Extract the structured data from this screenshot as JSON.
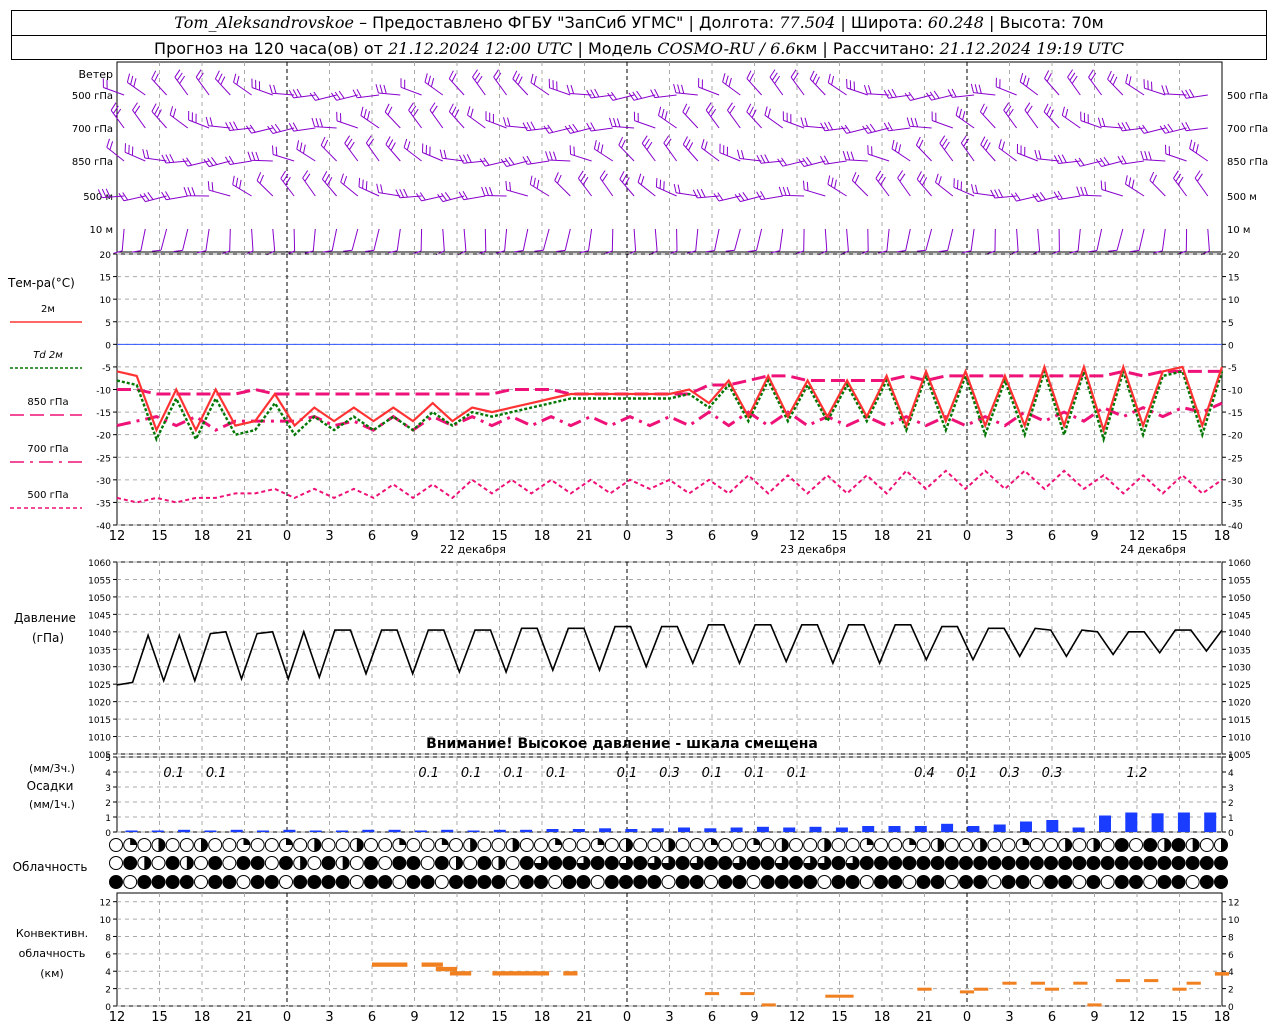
{
  "header": {
    "station": "Tom_Aleksandrovskoe",
    "provider": "Предоставлено ФГБУ \"ЗапСиб УГМС\"",
    "lon_label": "Долгота:",
    "lon": "77.504",
    "lat_label": "Широта:",
    "lat": "60.248",
    "alt_label": "Высота:",
    "alt": "70м",
    "forecast_label": "Прогноз на 120 часа(ов) от",
    "forecast_time": "21.12.2024 12:00 UTC",
    "model_label": "Модель",
    "model": "COSMO-RU / 6.6",
    "model_unit": "км",
    "calc_label": "Рассчитано:",
    "calc_time": "21.12.2024 19:19 UTC"
  },
  "colors": {
    "wind": "#8800cc",
    "t2m": "#ff3333",
    "td2m": "#007700",
    "t850": "#ee1177",
    "t700": "#ee1177",
    "t500": "#ee1177",
    "zero_line": "#3355ff",
    "pressure": "#000000",
    "precip": "#1a3cff",
    "convective": "#f08020"
  },
  "chart_data": [
    {
      "type": "barbs",
      "title": "Ветер",
      "levels": [
        "500 гПа",
        "700 гПа",
        "850 гПа",
        "500 м",
        "10 м"
      ]
    },
    {
      "type": "line",
      "title": "Тем-ра(°C)",
      "ylim": [
        -40,
        20
      ],
      "yticks": [
        20,
        15,
        10,
        5,
        0,
        -5,
        -10,
        -15,
        -20,
        -25,
        -30,
        -35,
        -40
      ],
      "xticks": [
        "12",
        "15",
        "18",
        "21",
        "0",
        "3",
        "6",
        "9",
        "12",
        "15",
        "18",
        "21",
        "0",
        "3",
        "6",
        "9",
        "12",
        "15",
        "18",
        "21",
        "0",
        "3",
        "6",
        "9",
        "12",
        "15",
        "18"
      ],
      "date_labels": [
        "22 декабря",
        "23 декабря",
        "24 декабря"
      ],
      "series": [
        {
          "name": "2м",
          "values": [
            -6,
            -7,
            -19,
            -10,
            -19,
            -10,
            -18,
            -17,
            -11,
            -18,
            -14,
            -17,
            -14,
            -17,
            -14,
            -17,
            -13,
            -17,
            -14,
            -15,
            -14,
            -13,
            -12,
            -11,
            -11,
            -11,
            -11,
            -11,
            -11,
            -10,
            -13,
            -8,
            -16,
            -7,
            -16,
            -8,
            -16,
            -8,
            -16,
            -7,
            -18,
            -6,
            -17,
            -6,
            -18,
            -7,
            -18,
            -5,
            -18,
            -5,
            -19,
            -5,
            -18,
            -6,
            -5,
            -18,
            -5
          ]
        },
        {
          "name": "Td 2м",
          "values": [
            -8,
            -9,
            -21,
            -12,
            -21,
            -12,
            -20,
            -19,
            -13,
            -20,
            -16,
            -19,
            -16,
            -19,
            -16,
            -19,
            -15,
            -18,
            -15,
            -16,
            -15,
            -14,
            -13,
            -12,
            -12,
            -12,
            -12,
            -12,
            -12,
            -11,
            -14,
            -9,
            -17,
            -8,
            -17,
            -9,
            -17,
            -9,
            -17,
            -8,
            -19,
            -7,
            -19,
            -7,
            -20,
            -8,
            -20,
            -6,
            -20,
            -6,
            -21,
            -6,
            -20,
            -7,
            -6,
            -20,
            -6
          ]
        },
        {
          "name": "850 гПа",
          "values": [
            -10,
            -10,
            -11,
            -11,
            -11,
            -11,
            -11,
            -10,
            -11,
            -11,
            -11,
            -11,
            -11,
            -11,
            -11,
            -11,
            -11,
            -11,
            -11,
            -11,
            -10,
            -10,
            -10,
            -11,
            -11,
            -11,
            -11,
            -11,
            -11,
            -11,
            -9,
            -9,
            -8,
            -7,
            -7,
            -8,
            -8,
            -8,
            -8,
            -8,
            -7,
            -8,
            -7,
            -7,
            -7,
            -7,
            -7,
            -7,
            -7,
            -7,
            -7,
            -6,
            -7,
            -6,
            -6,
            -6,
            -6
          ]
        },
        {
          "name": "700 гПа",
          "values": [
            -18,
            -17,
            -16,
            -18,
            -16,
            -19,
            -17,
            -17,
            -17,
            -17,
            -16,
            -18,
            -17,
            -19,
            -16,
            -19,
            -16,
            -18,
            -16,
            -18,
            -16,
            -18,
            -16,
            -18,
            -16,
            -18,
            -16,
            -18,
            -16,
            -18,
            -15,
            -18,
            -15,
            -18,
            -15,
            -18,
            -16,
            -18,
            -16,
            -18,
            -16,
            -18,
            -16,
            -18,
            -16,
            -18,
            -15,
            -17,
            -15,
            -17,
            -14,
            -16,
            -14,
            -16,
            -14,
            -15,
            -13
          ]
        },
        {
          "name": "500 гПа",
          "values": [
            -34,
            -35,
            -34,
            -35,
            -34,
            -34,
            -33,
            -33,
            -32,
            -34,
            -32,
            -34,
            -32,
            -34,
            -31,
            -34,
            -31,
            -34,
            -30,
            -33,
            -30,
            -33,
            -30,
            -33,
            -30,
            -33,
            -30,
            -32,
            -30,
            -33,
            -30,
            -33,
            -29,
            -33,
            -29,
            -33,
            -29,
            -33,
            -29,
            -33,
            -28,
            -32,
            -28,
            -32,
            -28,
            -32,
            -28,
            -32,
            -28,
            -32,
            -29,
            -33,
            -29,
            -33,
            -29,
            -33,
            -30
          ]
        }
      ]
    },
    {
      "type": "line",
      "title": "Давление",
      "units": "(гПа)",
      "ylim": [
        1005,
        1060
      ],
      "yticks": [
        1060,
        1055,
        1050,
        1045,
        1040,
        1035,
        1030,
        1025,
        1020,
        1015,
        1010,
        1005
      ],
      "warning": "Внимание! Высокое давление - шкала смещена",
      "series": [
        {
          "name": "pressure",
          "values": [
            1024.8,
            1025.5,
            1039.0,
            1026.0,
            1039.0,
            1026.0,
            1039.5,
            1040.0,
            1026.5,
            1039.5,
            1040.0,
            1026.5,
            1040.0,
            1027.0,
            1040.5,
            1040.5,
            1028.0,
            1040.5,
            1040.5,
            1028.0,
            1040.5,
            1040.5,
            1028.5,
            1040.5,
            1040.5,
            1028.5,
            1041.0,
            1041.0,
            1029.0,
            1041.0,
            1041.0,
            1029.0,
            1041.5,
            1041.5,
            1030.0,
            1041.5,
            1041.5,
            1031.0,
            1042.0,
            1042.0,
            1031.0,
            1042.0,
            1042.0,
            1031.5,
            1042.0,
            1042.0,
            1031.0,
            1042.0,
            1042.0,
            1031.0,
            1042.0,
            1042.0,
            1032.0,
            1041.5,
            1041.5,
            1032.0,
            1041.0,
            1041.0,
            1033.0,
            1041.0,
            1040.5,
            1033.0,
            1040.5,
            1040.0,
            1033.5,
            1040.0,
            1040.0,
            1034.0,
            1040.5,
            1040.5,
            1034.5,
            1040.5
          ]
        }
      ]
    },
    {
      "type": "bar",
      "title": "Осадки",
      "units_3h": "(мм/3ч.)",
      "units_1h": "(мм/1ч.)",
      "ylim": [
        0,
        5
      ],
      "yticks": [
        5,
        4,
        3,
        2,
        1,
        0
      ],
      "labels_3h": [
        "0.1",
        "0.1",
        "0.1",
        "0.1",
        "0.1",
        "0.1",
        "0.1",
        "0.3",
        "0.1",
        "0.1",
        "0.1",
        "0.4",
        "0.1",
        "0.3",
        "0.3",
        "1.2"
      ],
      "values": [
        0.1,
        0.1,
        0.15,
        0.1,
        0.15,
        0.1,
        0.15,
        0.1,
        0.1,
        0.15,
        0.15,
        0.1,
        0.15,
        0.1,
        0.15,
        0.15,
        0.2,
        0.2,
        0.25,
        0.2,
        0.25,
        0.3,
        0.25,
        0.3,
        0.35,
        0.3,
        0.35,
        0.3,
        0.4,
        0.4,
        0.4,
        0.55,
        0.4,
        0.5,
        0.7,
        0.8,
        0.3,
        1.1,
        1.3,
        1.25,
        1.3,
        1.3
      ]
    },
    {
      "type": "table",
      "title": "Облачность",
      "rows": 3,
      "note": "cloud cover symbols per time step (high / middle / low)"
    },
    {
      "type": "bar",
      "title": "Конвективн. облачность",
      "units": "(км)",
      "ylim": [
        0,
        13
      ],
      "yticks": [
        12,
        10,
        8,
        6,
        4,
        2,
        0
      ],
      "segments": [
        {
          "x0": 18.0,
          "x1": 20.5,
          "y0": 4.5,
          "y1": 5.0
        },
        {
          "x0": 21.5,
          "x1": 23.0,
          "y0": 4.5,
          "y1": 5.0
        },
        {
          "x0": 22.5,
          "x1": 24.0,
          "y0": 4.0,
          "y1": 4.5
        },
        {
          "x0": 23.5,
          "x1": 25.0,
          "y0": 3.5,
          "y1": 4.0
        },
        {
          "x0": 26.5,
          "x1": 30.5,
          "y0": 3.5,
          "y1": 4.0
        },
        {
          "x0": 31.5,
          "x1": 32.5,
          "y0": 3.5,
          "y1": 4.0
        },
        {
          "x0": 41.5,
          "x1": 42.5,
          "y0": 1.3,
          "y1": 1.6
        },
        {
          "x0": 44.0,
          "x1": 45.0,
          "y0": 1.3,
          "y1": 1.6
        },
        {
          "x0": 45.5,
          "x1": 46.5,
          "y0": 0.0,
          "y1": 0.3
        },
        {
          "x0": 50.0,
          "x1": 52.0,
          "y0": 1.0,
          "y1": 1.3
        },
        {
          "x0": 56.5,
          "x1": 57.5,
          "y0": 1.8,
          "y1": 2.1
        },
        {
          "x0": 59.5,
          "x1": 60.5,
          "y0": 1.5,
          "y1": 1.8
        },
        {
          "x0": 60.5,
          "x1": 61.5,
          "y0": 1.8,
          "y1": 2.1
        },
        {
          "x0": 62.5,
          "x1": 63.5,
          "y0": 2.5,
          "y1": 2.8
        },
        {
          "x0": 64.5,
          "x1": 65.5,
          "y0": 2.5,
          "y1": 2.8
        },
        {
          "x0": 65.5,
          "x1": 66.5,
          "y0": 1.8,
          "y1": 2.1
        },
        {
          "x0": 67.5,
          "x1": 68.5,
          "y0": 2.5,
          "y1": 2.8
        },
        {
          "x0": 68.5,
          "x1": 69.5,
          "y0": 0.0,
          "y1": 0.3
        },
        {
          "x0": 70.5,
          "x1": 71.5,
          "y0": 2.8,
          "y1": 3.1
        },
        {
          "x0": 72.5,
          "x1": 73.5,
          "y0": 2.8,
          "y1": 3.1
        },
        {
          "x0": 74.5,
          "x1": 75.5,
          "y0": 1.8,
          "y1": 2.1
        },
        {
          "x0": 75.5,
          "x1": 76.5,
          "y0": 2.5,
          "y1": 2.8
        },
        {
          "x0": 77.5,
          "x1": 78.5,
          "y0": 3.5,
          "y1": 3.9
        }
      ]
    }
  ]
}
